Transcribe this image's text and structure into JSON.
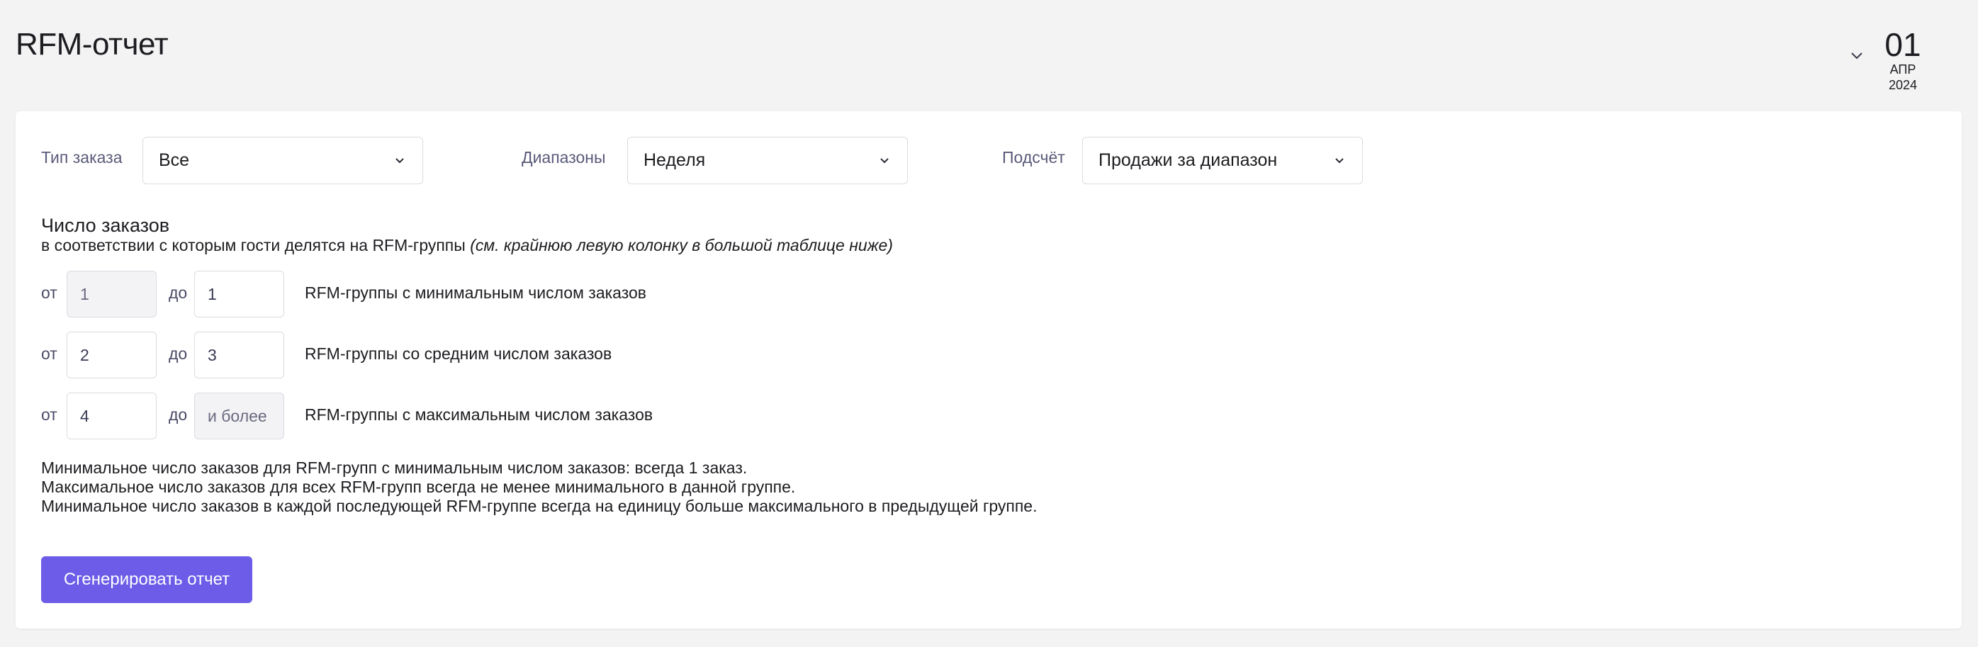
{
  "header": {
    "title": "RFM-отчет",
    "date": {
      "day": "01",
      "month": "АПР",
      "year": "2024"
    }
  },
  "filters": {
    "order_type": {
      "label": "Тип заказа",
      "value": "Все"
    },
    "ranges": {
      "label": "Диапазоны",
      "value": "Неделя"
    },
    "counting": {
      "label": "Подсчёт",
      "value": "Продажи за диапазон"
    }
  },
  "orders_section": {
    "title": "Число заказов",
    "subtitle": "в соответствии с которым гости делятся на RFM-группы",
    "subtitle_note": "(см. крайнюю левую колонку в большой таблице ниже)",
    "from_label": "от",
    "to_label": "до",
    "rows": [
      {
        "from": "1",
        "to": "1",
        "description": "RFM-группы с минимальным числом заказов"
      },
      {
        "from": "2",
        "to": "3",
        "description": "RFM-группы со средним числом заказов"
      },
      {
        "from": "4",
        "to": "и более",
        "description": "RFM-группы с максимальным числом заказов"
      }
    ]
  },
  "notes": [
    "Минимальное число заказов для RFM-групп с минимальным числом заказов: всегда 1 заказ.",
    "Максимальное число заказов для всех RFM-групп всегда не менее минимального в данной группе.",
    "Минимальное число заказов в каждой последующей RFM-группе всегда на единицу больше максимального в предыдущей группе."
  ],
  "actions": {
    "generate_label": "Сгенерировать отчет"
  },
  "colors": {
    "accent": "#6c5ce7",
    "label": "#5a5a7a",
    "background": "#f3f3f4"
  }
}
